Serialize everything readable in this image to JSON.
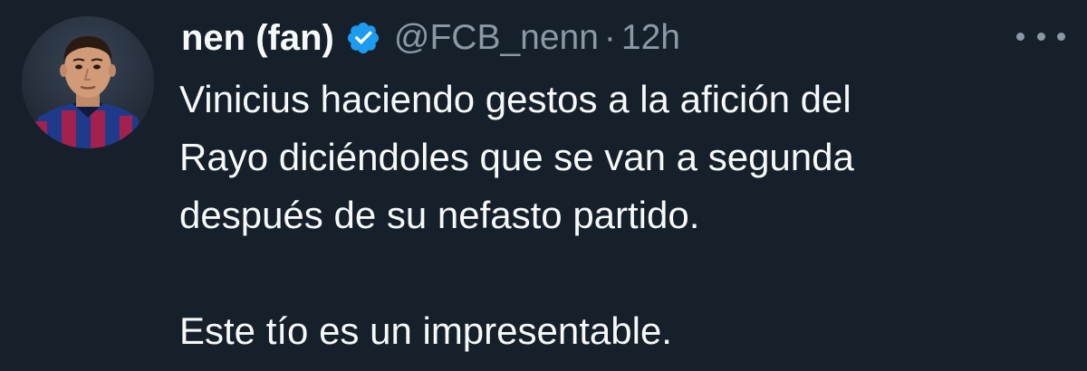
{
  "tweet": {
    "author": {
      "display_name": "nen (fan)",
      "verified_icon": "verified-badge-icon",
      "handle": "@FCB_nenn",
      "separator": "·",
      "time": "12h"
    },
    "more_icon": "more-options-icon",
    "text": {
      "line1": "Vinicius haciendo gestos a la afición del",
      "line2": "Rayo diciéndoles que se van a segunda",
      "line3": "después de su nefasto partido.",
      "line4": "Este tío es un impresentable."
    },
    "colors": {
      "background": "#15202b",
      "text": "#f7f9f9",
      "secondary": "#8b98a5",
      "verified": "#1d9bf0"
    }
  }
}
